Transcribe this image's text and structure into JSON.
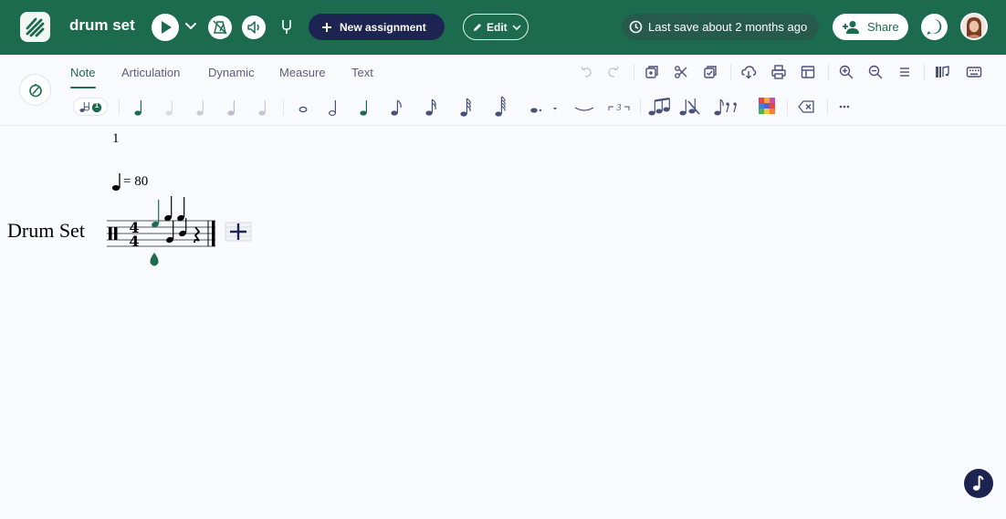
{
  "app": {
    "doc_title": "drum set",
    "new_assignment_label": "New assignment",
    "edit_label": "Edit",
    "last_save": "Last save about 2 months ago",
    "share_label": "Share"
  },
  "tabs": [
    {
      "label": "Note",
      "active": true
    },
    {
      "label": "Articulation",
      "active": false
    },
    {
      "label": "Dynamic",
      "active": false
    },
    {
      "label": "Measure",
      "active": false
    },
    {
      "label": "Text",
      "active": false
    }
  ],
  "toolbar": {
    "voice_badge": "1"
  },
  "score": {
    "measure_number": "1",
    "tempo_text": "= 80",
    "instrument_name": "Drum Set",
    "time_signature": [
      "4",
      "4"
    ]
  },
  "colors": {
    "brand": "#1c6b4e",
    "navy": "#1e2452",
    "background": "#f9fafd"
  }
}
